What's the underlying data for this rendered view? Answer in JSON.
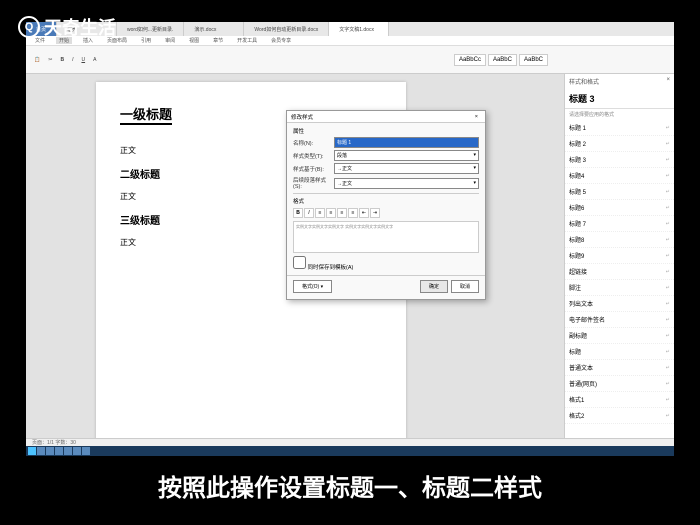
{
  "watermark": "天奇生活",
  "subtitle": "按照此操作设置标题一、标题二样式",
  "tabs": {
    "home": "首页",
    "t1": "稻壳",
    "t2": "word如何...更新目录.",
    "t3": "演示.docx",
    "t4": "Word如何自动更新目录.docx",
    "active": "文字文稿1.docx"
  },
  "ribbon": {
    "items": [
      "文件",
      "开始",
      "插入",
      "页面布局",
      "引用",
      "审阅",
      "视图",
      "章节",
      "开发工具",
      "会员专享"
    ],
    "stylePreview1": "AaBbCc",
    "stylePreview2": "AaBbC",
    "stylePreview3": "AaBbC"
  },
  "page": {
    "h1": "一级标题",
    "p1": "正文",
    "h2": "二级标题",
    "p2": "正文",
    "h3": "三级标题",
    "p3": "正文"
  },
  "dialog": {
    "title": "修改样式",
    "section1": "属性",
    "nameLabel": "名称(N):",
    "nameValue": "标题 1",
    "typeLabel": "样式类型(T):",
    "typeValue": "段落",
    "baseLabel": "样式基于(B):",
    "baseValue": "→正文",
    "nextLabel": "后续段落样式(S):",
    "nextValue": "→正文",
    "section2": "格式",
    "preview": "实例文字实例文字实例文字   实例文字实例文字实例文字",
    "checkbox": "同时保存到模板(A)",
    "formatBtn": "格式(O) ▾",
    "ok": "确定",
    "cancel": "取消"
  },
  "panel": {
    "title": "样式和格式",
    "current": "标题 3",
    "hint": "请选择要应用的格式",
    "items": [
      "标题 1",
      "标题 2",
      "标题 3",
      "标题4",
      "标题 5",
      "标题6",
      "标题 7",
      "标题8",
      "标题9",
      "超链接",
      "脚注",
      "列出文本",
      "电子邮件签名",
      "副标题",
      "标题",
      "普通文本",
      "普通(网页)",
      "格式1",
      "格式2"
    ]
  },
  "statusbar": "页面：1/1  字数：30",
  "colors": {
    "accent": "#4a7ab8",
    "selection": "#2868c8"
  }
}
